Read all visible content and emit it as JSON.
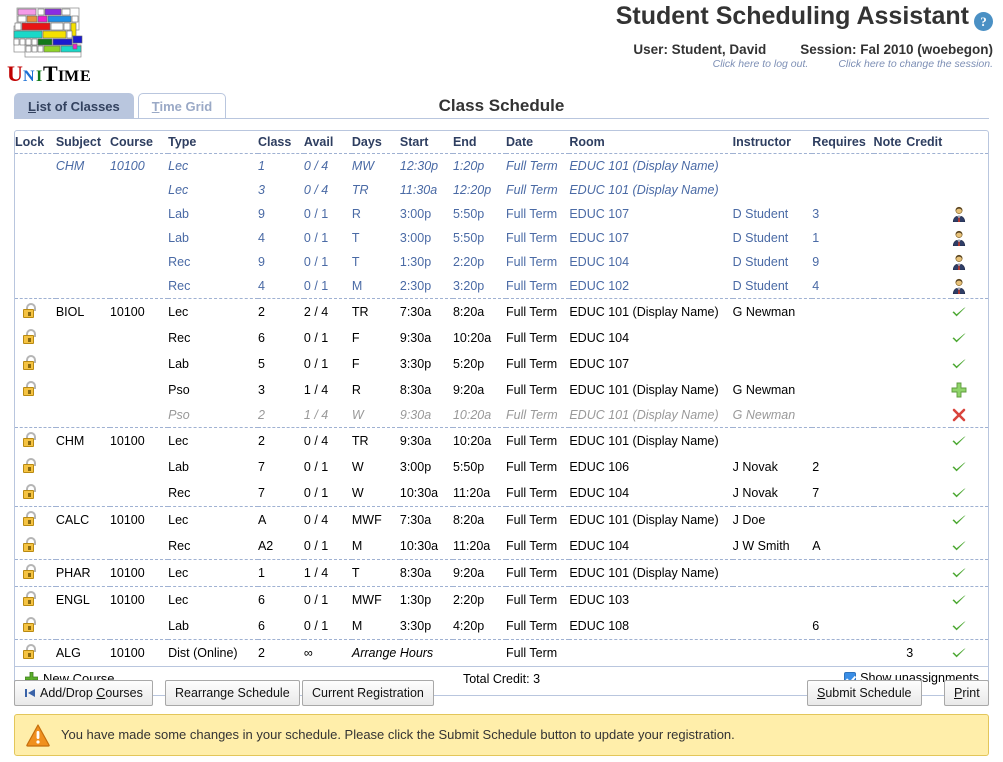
{
  "app": {
    "title": "Student Scheduling Assistant",
    "help_icon": "help-icon",
    "user_label": "User: Student, David",
    "user_sub": "Click here to log out.",
    "session_label": "Session: Fal 2010 (woebegon)",
    "session_sub": "Click here to change the session.",
    "logo_text": "UniTime"
  },
  "tabs": [
    {
      "label": "List of Classes",
      "accel": "L",
      "rest": "ist of Classes",
      "active": true
    },
    {
      "label": "Time Grid",
      "accel": "T",
      "rest": "ime Grid",
      "active": false
    }
  ],
  "page_title": "Class Schedule",
  "table": {
    "headers": [
      "Lock",
      "Subject",
      "Course",
      "Type",
      "Class",
      "Avail",
      "Days",
      "Start",
      "End",
      "Date",
      "Room",
      "Instructor",
      "Requires",
      "Note",
      "Credit",
      ""
    ],
    "rows": [
      {
        "group_start": true,
        "style": "blue-italic",
        "lock": false,
        "subject": "CHM",
        "course": "10100",
        "type": "Lec",
        "class": "1",
        "avail": "0 / 4",
        "days": "MW",
        "start": "12:30p",
        "end": "1:20p",
        "date": "Full Term",
        "room": "EDUC 101 (Display Name)",
        "instructor": "",
        "requires": "",
        "note": "",
        "credit": "",
        "status": ""
      },
      {
        "group_start": false,
        "style": "blue-italic",
        "lock": false,
        "subject": "",
        "course": "",
        "type": "Lec",
        "class": "3",
        "avail": "0 / 4",
        "days": "TR",
        "start": "11:30a",
        "end": "12:20p",
        "date": "Full Term",
        "room": "EDUC 101 (Display Name)",
        "instructor": "",
        "requires": "",
        "note": "",
        "credit": "",
        "status": ""
      },
      {
        "group_start": false,
        "style": "blue",
        "lock": false,
        "subject": "",
        "course": "",
        "type": "Lab",
        "class": "9",
        "avail": "0 / 1",
        "days": "R",
        "start": "3:00p",
        "end": "5:50p",
        "date": "Full Term",
        "room": "EDUC 107",
        "instructor": "D Student",
        "requires": "3",
        "note": "",
        "credit": "",
        "status": "person"
      },
      {
        "group_start": false,
        "style": "blue",
        "lock": false,
        "subject": "",
        "course": "",
        "type": "Lab",
        "class": "4",
        "avail": "0 / 1",
        "days": "T",
        "start": "3:00p",
        "end": "5:50p",
        "date": "Full Term",
        "room": "EDUC 107",
        "instructor": "D Student",
        "requires": "1",
        "note": "",
        "credit": "",
        "status": "person"
      },
      {
        "group_start": false,
        "style": "blue",
        "lock": false,
        "subject": "",
        "course": "",
        "type": "Rec",
        "class": "9",
        "avail": "0 / 1",
        "days": "T",
        "start": "1:30p",
        "end": "2:20p",
        "date": "Full Term",
        "room": "EDUC 104",
        "instructor": "D Student",
        "requires": "9",
        "note": "",
        "credit": "",
        "status": "person"
      },
      {
        "group_start": false,
        "style": "blue",
        "lock": false,
        "subject": "",
        "course": "",
        "type": "Rec",
        "class": "4",
        "avail": "0 / 1",
        "days": "M",
        "start": "2:30p",
        "end": "3:20p",
        "date": "Full Term",
        "room": "EDUC 102",
        "instructor": "D Student",
        "requires": "4",
        "note": "",
        "credit": "",
        "status": "person"
      },
      {
        "group_start": true,
        "style": "normal",
        "lock": true,
        "subject": "BIOL",
        "course": "10100",
        "type": "Lec",
        "class": "2",
        "avail": "2 / 4",
        "days": "TR",
        "start": "7:30a",
        "end": "8:20a",
        "date": "Full Term",
        "room": "EDUC 101 (Display Name)",
        "instructor": "G Newman",
        "requires": "",
        "note": "",
        "credit": "",
        "status": "check"
      },
      {
        "group_start": false,
        "style": "normal",
        "lock": true,
        "subject": "",
        "course": "",
        "type": "Rec",
        "class": "6",
        "avail": "0 / 1",
        "days": "F",
        "start": "9:30a",
        "end": "10:20a",
        "date": "Full Term",
        "room": "EDUC 104",
        "instructor": "",
        "requires": "",
        "note": "",
        "credit": "",
        "status": "check"
      },
      {
        "group_start": false,
        "style": "normal",
        "lock": true,
        "subject": "",
        "course": "",
        "type": "Lab",
        "class": "5",
        "avail": "0 / 1",
        "days": "F",
        "start": "3:30p",
        "end": "5:20p",
        "date": "Full Term",
        "room": "EDUC 107",
        "instructor": "",
        "requires": "",
        "note": "",
        "credit": "",
        "status": "check"
      },
      {
        "group_start": false,
        "style": "normal",
        "lock": true,
        "subject": "",
        "course": "",
        "type": "Pso",
        "class": "3",
        "avail": "1 / 4",
        "days": "R",
        "start": "8:30a",
        "end": "9:20a",
        "date": "Full Term",
        "room": "EDUC 101 (Display Name)",
        "instructor": "G Newman",
        "requires": "",
        "note": "",
        "credit": "",
        "status": "plus"
      },
      {
        "group_start": false,
        "style": "grey",
        "lock": false,
        "subject": "",
        "course": "",
        "type": "Pso",
        "class": "2",
        "avail": "1 / 4",
        "days": "W",
        "start": "9:30a",
        "end": "10:20a",
        "date": "Full Term",
        "room": "EDUC 101 (Display Name)",
        "instructor": "G Newman",
        "requires": "",
        "note": "",
        "credit": "",
        "status": "cross"
      },
      {
        "group_start": true,
        "style": "normal",
        "lock": true,
        "subject": "CHM",
        "course": "10100",
        "type": "Lec",
        "class": "2",
        "avail": "0 / 4",
        "days": "TR",
        "start": "9:30a",
        "end": "10:20a",
        "date": "Full Term",
        "room": "EDUC 101 (Display Name)",
        "instructor": "",
        "requires": "",
        "note": "",
        "credit": "",
        "status": "check"
      },
      {
        "group_start": false,
        "style": "normal",
        "lock": true,
        "subject": "",
        "course": "",
        "type": "Lab",
        "class": "7",
        "avail": "0 / 1",
        "days": "W",
        "start": "3:00p",
        "end": "5:50p",
        "date": "Full Term",
        "room": "EDUC 106",
        "instructor": "J Novak",
        "requires": "2",
        "note": "",
        "credit": "",
        "status": "check"
      },
      {
        "group_start": false,
        "style": "normal",
        "lock": true,
        "subject": "",
        "course": "",
        "type": "Rec",
        "class": "7",
        "avail": "0 / 1",
        "days": "W",
        "start": "10:30a",
        "end": "11:20a",
        "date": "Full Term",
        "room": "EDUC 104",
        "instructor": "J Novak",
        "requires": "7",
        "note": "",
        "credit": "",
        "status": "check"
      },
      {
        "group_start": true,
        "style": "normal",
        "lock": true,
        "subject": "CALC",
        "course": "10100",
        "type": "Lec",
        "class": "A",
        "avail": "0 / 4",
        "days": "MWF",
        "start": "7:30a",
        "end": "8:20a",
        "date": "Full Term",
        "room": "EDUC 101 (Display Name)",
        "instructor": "J Doe",
        "requires": "",
        "note": "",
        "credit": "",
        "status": "check"
      },
      {
        "group_start": false,
        "style": "normal",
        "lock": true,
        "subject": "",
        "course": "",
        "type": "Rec",
        "class": "A2",
        "avail": "0 / 1",
        "days": "M",
        "start": "10:30a",
        "end": "11:20a",
        "date": "Full Term",
        "room": "EDUC 104",
        "instructor": "J W Smith",
        "requires": "A",
        "note": "",
        "credit": "",
        "status": "check"
      },
      {
        "group_start": true,
        "style": "normal",
        "lock": true,
        "subject": "PHAR",
        "course": "10100",
        "type": "Lec",
        "class": "1",
        "avail": "1 / 4",
        "days": "T",
        "start": "8:30a",
        "end": "9:20a",
        "date": "Full Term",
        "room": "EDUC 101 (Display Name)",
        "instructor": "",
        "requires": "",
        "note": "",
        "credit": "",
        "status": "check"
      },
      {
        "group_start": true,
        "style": "normal",
        "lock": true,
        "subject": "ENGL",
        "course": "10100",
        "type": "Lec",
        "class": "6",
        "avail": "0 / 1",
        "days": "MWF",
        "start": "1:30p",
        "end": "2:20p",
        "date": "Full Term",
        "room": "EDUC 103",
        "instructor": "",
        "requires": "",
        "note": "",
        "credit": "",
        "status": "check"
      },
      {
        "group_start": false,
        "style": "normal",
        "lock": true,
        "subject": "",
        "course": "",
        "type": "Lab",
        "class": "6",
        "avail": "0 / 1",
        "days": "M",
        "start": "3:30p",
        "end": "4:20p",
        "date": "Full Term",
        "room": "EDUC 108",
        "instructor": "",
        "requires": "6",
        "note": "",
        "credit": "",
        "status": "check"
      },
      {
        "group_start": true,
        "style": "normal",
        "lock": true,
        "subject": "ALG",
        "course": "10100",
        "type": "Dist (Online)",
        "class": "2",
        "avail": "∞",
        "days": "",
        "start": "",
        "end": "",
        "arrange": "Arrange Hours",
        "date": "Full Term",
        "room": "",
        "instructor": "",
        "requires": "",
        "note": "",
        "credit": "3",
        "status": "check"
      }
    ]
  },
  "footer": {
    "new_course": "New Course",
    "new_course_accel": "N",
    "new_course_rest": "ew Course",
    "total_credit": "Total Credit: 3",
    "show_unassignments": "Show unassignments",
    "show_unassignments_checked": true
  },
  "buttons": [
    {
      "label": "Add/Drop Courses",
      "accel": "C",
      "pre": "Add/Drop ",
      "rest": "ourses",
      "icon": "left-arrow-icon"
    },
    {
      "label": "Rearrange Schedule",
      "accel": "",
      "pre": "Rearrange Schedule",
      "rest": "",
      "icon": ""
    },
    {
      "label": "Current Registration",
      "accel": "",
      "pre": "Current Registration",
      "rest": "",
      "icon": ""
    },
    {
      "label": "Submit Schedule",
      "accel": "S",
      "pre": "",
      "rest": "ubmit Schedule",
      "icon": ""
    },
    {
      "label": "Print",
      "accel": "P",
      "pre": "",
      "rest": "rint",
      "icon": ""
    }
  ],
  "warning": {
    "icon": "warning-triangle-icon",
    "text": "You have made some changes in your schedule. Please click the Submit Schedule button to update your registration."
  },
  "colors": {
    "accent_blue": "#b9c6de",
    "link_blue": "#4a6aa5",
    "warn_bg": "#ffeeaa",
    "warn_border": "#e3c65a",
    "check_green": "#4ca832",
    "cross_red": "#d9443c"
  }
}
